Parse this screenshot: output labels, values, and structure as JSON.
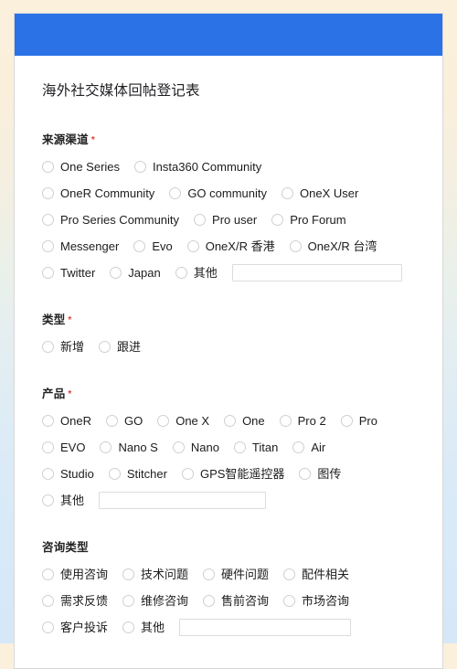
{
  "card": {
    "title": "海外社交媒体回帖登记表",
    "header_color": "#2a72e5",
    "required_marker": "*"
  },
  "sections": [
    {
      "key": "source_channel",
      "label": "来源渠道",
      "required": true,
      "rows": [
        [
          "One Series",
          "Insta360 Community"
        ],
        [
          "OneR Community",
          "GO community",
          "OneX User"
        ],
        [
          "Pro Series Community",
          "Pro user",
          "Pro Forum"
        ],
        [
          "Messenger",
          "Evo",
          "OneX/R 香港",
          "OneX/R 台湾"
        ],
        [
          "Twitter",
          "Japan",
          "其他"
        ]
      ],
      "other_input": {
        "value": "",
        "placeholder": ""
      }
    },
    {
      "key": "type",
      "label": "类型",
      "required": true,
      "rows": [
        [
          "新增",
          "跟进"
        ]
      ]
    },
    {
      "key": "product",
      "label": "产品",
      "required": true,
      "rows": [
        [
          "OneR",
          "GO",
          "One X",
          "One",
          "Pro 2",
          "Pro"
        ],
        [
          "EVO",
          "Nano S",
          "Nano",
          "Titan",
          "Air"
        ],
        [
          "Studio",
          "Stitcher",
          "GPS智能遥控器",
          "图传"
        ],
        [
          "其他"
        ]
      ],
      "other_input": {
        "value": "",
        "placeholder": ""
      }
    },
    {
      "key": "inquiry_type",
      "label": "咨询类型",
      "required": false,
      "rows": [
        [
          "使用咨询",
          "技术问题",
          "硬件问题",
          "配件相关"
        ],
        [
          "需求反馈",
          "维修咨询",
          "售前咨询",
          "市场咨询"
        ],
        [
          "客户投诉",
          "其他"
        ]
      ],
      "other_input": {
        "value": "",
        "placeholder": ""
      }
    }
  ]
}
